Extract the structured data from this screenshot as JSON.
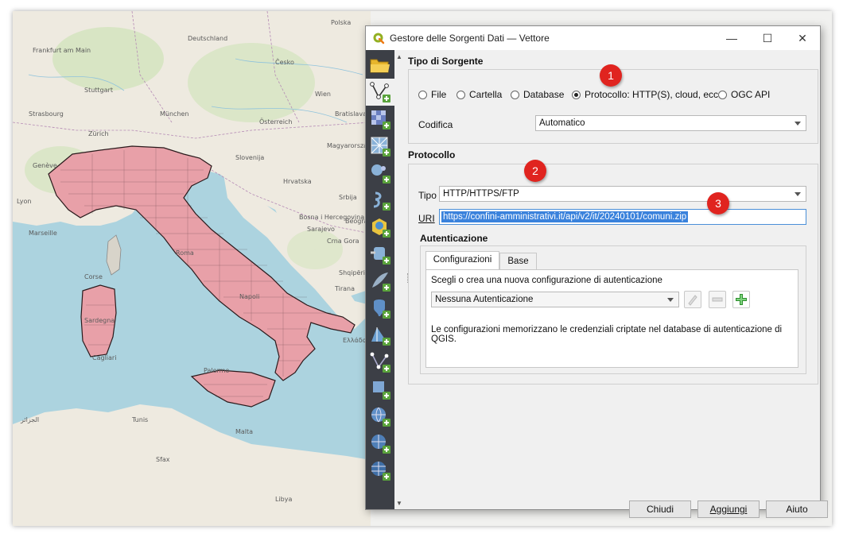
{
  "window": {
    "title": "Gestore delle Sorgenti Dati — Vettore",
    "minimize": "—",
    "maximize": "☐",
    "close": "✕"
  },
  "sidebar": {
    "items": [
      "open-folder-icon",
      "vector-layer-icon",
      "raster-layer-icon",
      "mesh-layer-icon",
      "point-cloud-icon",
      "vector-tile-icon",
      "delimited-text-icon",
      "geopackage-icon",
      "spatialite-icon",
      "postgresql-icon",
      "mssql-icon",
      "oracle-icon",
      "virtual-layer-icon",
      "wms-icon",
      "wfs-icon",
      "arcgis-rest-icon",
      "xyz-icon"
    ]
  },
  "source_type": {
    "heading": "Tipo di Sorgente",
    "options": [
      "File",
      "Cartella",
      "Database",
      "Protocollo: HTTP(S), cloud, ecc.",
      "OGC API"
    ],
    "selected_index": 3,
    "encoding_label": "Codifica",
    "encoding_value": "Automatico"
  },
  "protocol": {
    "heading": "Protocollo",
    "type_label": "Tipo",
    "type_value": "HTTP/HTTPS/FTP",
    "uri_label": "URI",
    "uri_value": "https://confini-amministrativi.it/api/v2/it/20240101/comuni.zip"
  },
  "auth": {
    "heading": "Autenticazione",
    "tabs": [
      "Configurazioni",
      "Base"
    ],
    "choose_label": "Scegli o crea una nuova configurazione di autenticazione",
    "config_value": "Nessuna Autenticazione",
    "info_text": "Le configurazioni memorizzano le credenziali criptate nel database di autenticazione di QGIS."
  },
  "buttons": {
    "close": "Chiudi",
    "add": "Aggiungi",
    "help": "Aiuto"
  },
  "annotations": [
    "1",
    "2",
    "3"
  ],
  "map_labels": {
    "left_col": [
      "Frankfurt am Main",
      "Stuttgart",
      "Strasbourg",
      "Zürich",
      "Genève",
      "Lyon",
      "Marseille",
      "Corse",
      "Sardegna",
      "Cagliari",
      "Tunis",
      "Sfax",
      "الجزائر"
    ],
    "right_col": [
      "Deutschland",
      "München",
      "Österreich",
      "Slovenija",
      "Hrvatska",
      "Bosna i Hercegovina",
      "Crna Gora",
      "Shqipëria",
      "Roma",
      "Napoli",
      "Palermo",
      "Malta",
      "Polska",
      "Česko",
      "Magyarország",
      "Srbija",
      "Wien",
      "Beograd",
      "Bratislava",
      "Sarajevo",
      "Tirana",
      "Ελλάδα",
      "Libya"
    ]
  },
  "colors": {
    "accent": "#3a82dc",
    "italy_fill": "#e8a0a8",
    "sea": "#acd3df",
    "sidebar": "#3c3f46",
    "badge": "#e0241f"
  }
}
